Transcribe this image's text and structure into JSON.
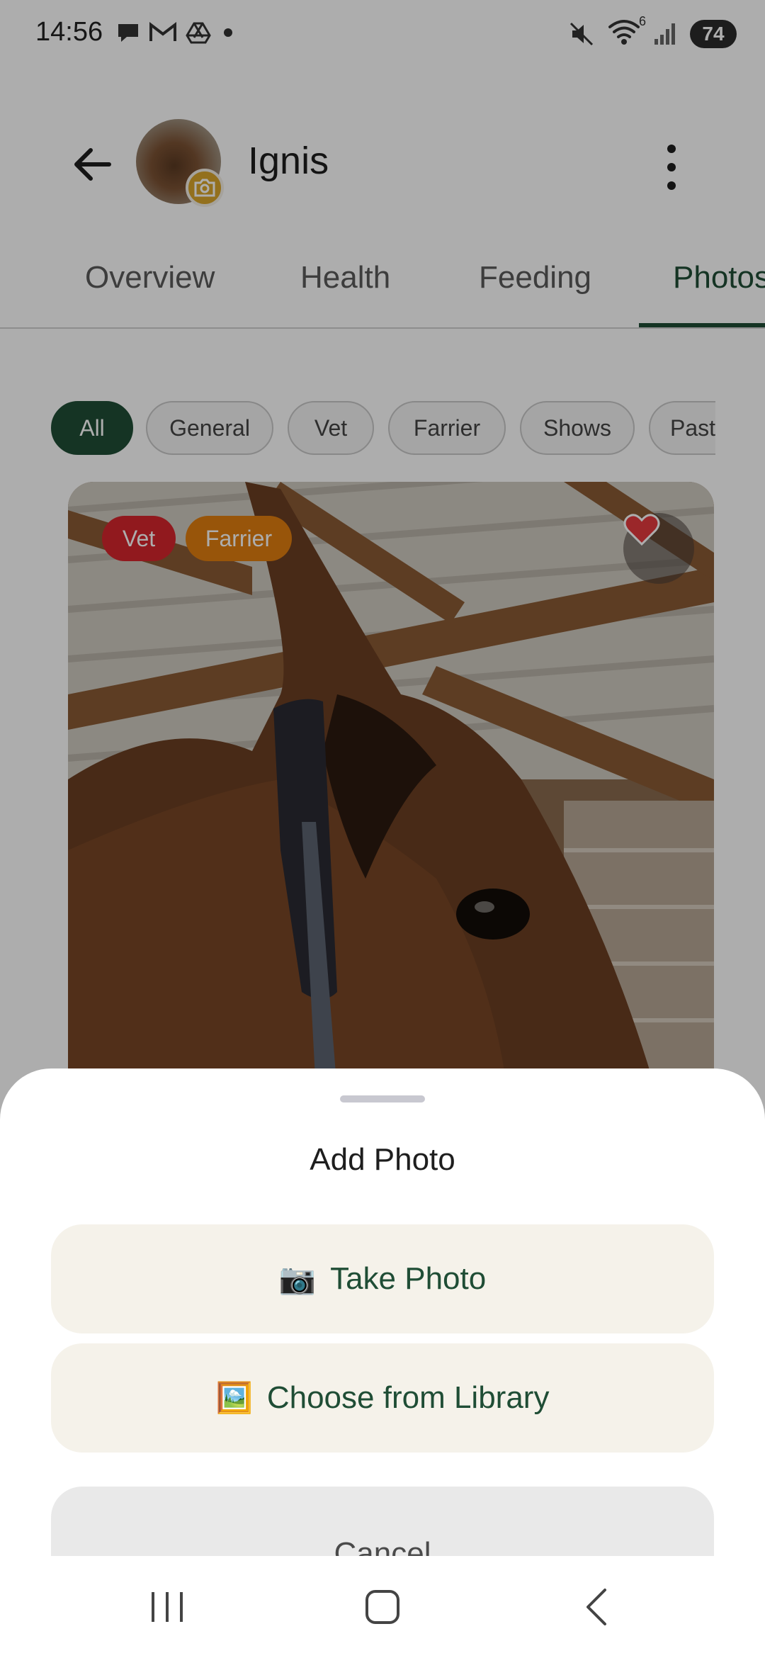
{
  "status_bar": {
    "time": "14:56",
    "left_icons": [
      "chat-bubble-icon",
      "gmail-icon",
      "google-drive-icon",
      "dot-icon"
    ],
    "right_icons": [
      "mute-icon",
      "wifi-icon",
      "signal-icon"
    ],
    "wifi_label": "6",
    "battery": "74"
  },
  "header": {
    "horse_name": "Ignis",
    "back_icon": "arrow-left-icon",
    "more_icon": "more-vertical-icon",
    "avatar_badge_icon": "camera-icon"
  },
  "tabs": [
    {
      "label": "Overview",
      "active": false
    },
    {
      "label": "Health",
      "active": false
    },
    {
      "label": "Feeding",
      "active": false
    },
    {
      "label": "Photos",
      "active": true
    }
  ],
  "filters": [
    {
      "label": "All",
      "active": true
    },
    {
      "label": "General",
      "active": false
    },
    {
      "label": "Vet",
      "active": false
    },
    {
      "label": "Farrier",
      "active": false
    },
    {
      "label": "Shows",
      "active": false
    },
    {
      "label": "Past",
      "active": false
    }
  ],
  "photo": {
    "tags": [
      {
        "label": "Vet",
        "color": "#d6262d"
      },
      {
        "label": "Farrier",
        "color": "#e07e10"
      }
    ],
    "favorite": true
  },
  "sheet": {
    "title": "Add Photo",
    "take_photo_emoji": "📷",
    "take_photo": "Take Photo",
    "library_emoji": "🖼️",
    "library": "Choose from Library",
    "cancel": "Cancel"
  },
  "colors": {
    "primary": "#1f4d35",
    "sheet_button_bg": "#f5f2ea",
    "vet_tag": "#d6262d",
    "farrier_tag": "#e07e10"
  }
}
